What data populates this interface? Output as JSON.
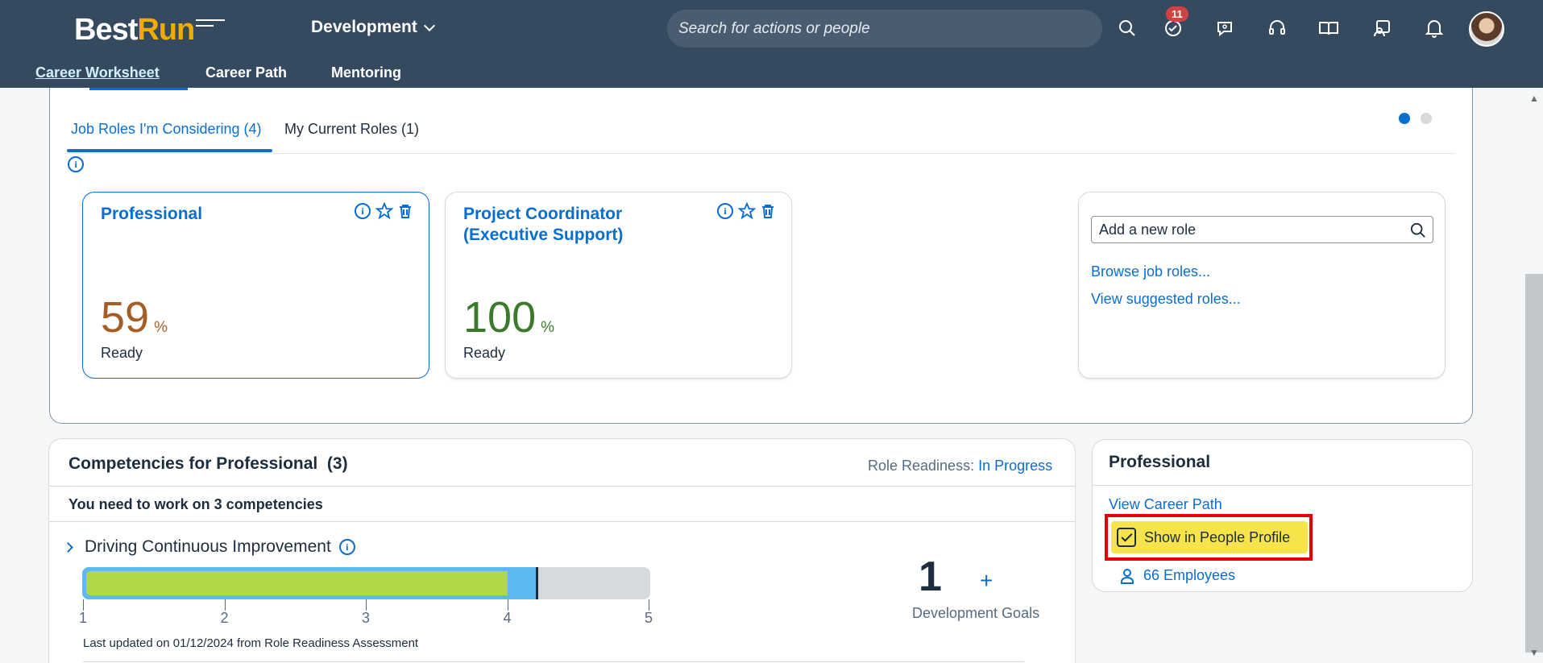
{
  "shell": {
    "logo_best": "Best",
    "logo_run": "Run",
    "product": "Development",
    "search_placeholder": "Search for actions or people",
    "notifications_count": "11",
    "icons": [
      "search-icon",
      "task-check-icon",
      "chat-icon",
      "headset-icon",
      "learning-icon",
      "people-assist-icon",
      "bell-icon"
    ]
  },
  "nav": {
    "items": [
      {
        "label": "Career Worksheet",
        "active": true
      },
      {
        "label": "Career Path",
        "active": false
      },
      {
        "label": "Mentoring",
        "active": false
      }
    ]
  },
  "roles": {
    "tabs": [
      {
        "label": "Job Roles I'm Considering (4)",
        "active": true
      },
      {
        "label": "My Current Roles (1)",
        "active": false
      }
    ],
    "cards": [
      {
        "title": "Professional",
        "percent": "59",
        "unit": "%",
        "status": "Ready",
        "color": "#a45d25"
      },
      {
        "title": "Project Coordinator (Executive Support)",
        "percent": "100",
        "unit": "%",
        "status": "Ready",
        "color": "#3b7a2d"
      }
    ],
    "add_role": {
      "placeholder": "Add a new role",
      "browse_link": "Browse job roles...",
      "suggested_link": "View suggested roles..."
    }
  },
  "competencies": {
    "title": "Competencies for Professional",
    "count": "(3)",
    "role_readiness_label": "Role Readiness:",
    "role_readiness_value": "In Progress",
    "need_text": "You need to work on 3 competencies",
    "items": [
      {
        "name": "Driving Continuous Improvement",
        "scale": [
          "1",
          "2",
          "3",
          "4",
          "5"
        ],
        "self_rating": 4,
        "expected_rating": 4.2,
        "updated_text": "Last updated on 01/12/2024 from Role Readiness Assessment",
        "goals_count": "1",
        "goals_plus": "+",
        "goals_label": "Development Goals"
      }
    ]
  },
  "profile_panel": {
    "title": "Professional",
    "career_path_link": "View Career Path",
    "show_in_profile_label": "Show in People Profile",
    "show_in_profile_checked": true,
    "employees_label": "66 Employees"
  }
}
